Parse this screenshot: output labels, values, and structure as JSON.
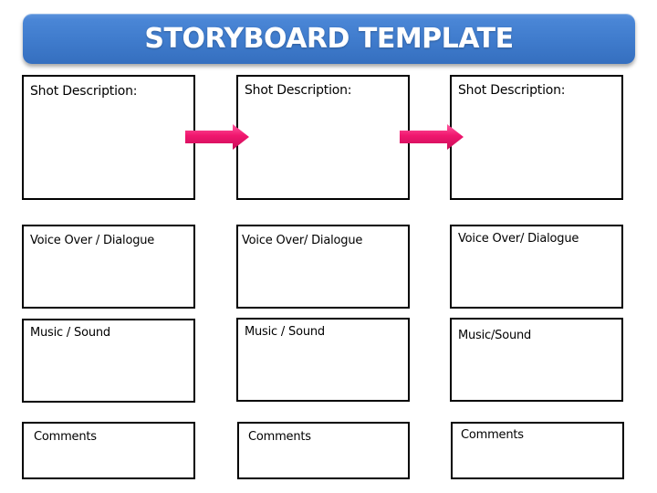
{
  "title": "STORYBOARD TEMPLATE",
  "colors": {
    "banner": "#3f7bcc",
    "arrow": "#f0166e",
    "box_border": "#000000"
  },
  "panels": [
    {
      "shot_description": "Shot Description:",
      "voice_over": "Voice Over / Dialogue",
      "music_sound": "Music / Sound",
      "comments": "Comments"
    },
    {
      "shot_description": "Shot Description:",
      "voice_over": "Voice Over/ Dialogue",
      "music_sound": "Music / Sound",
      "comments": "Comments"
    },
    {
      "shot_description": "Shot Description:",
      "voice_over": "Voice Over/ Dialogue",
      "music_sound": "Music/Sound",
      "comments": "Comments"
    }
  ],
  "arrows": [
    {
      "icon": "right-arrow-icon",
      "from": 1,
      "to": 2
    },
    {
      "icon": "right-arrow-icon",
      "from": 2,
      "to": 3
    }
  ]
}
